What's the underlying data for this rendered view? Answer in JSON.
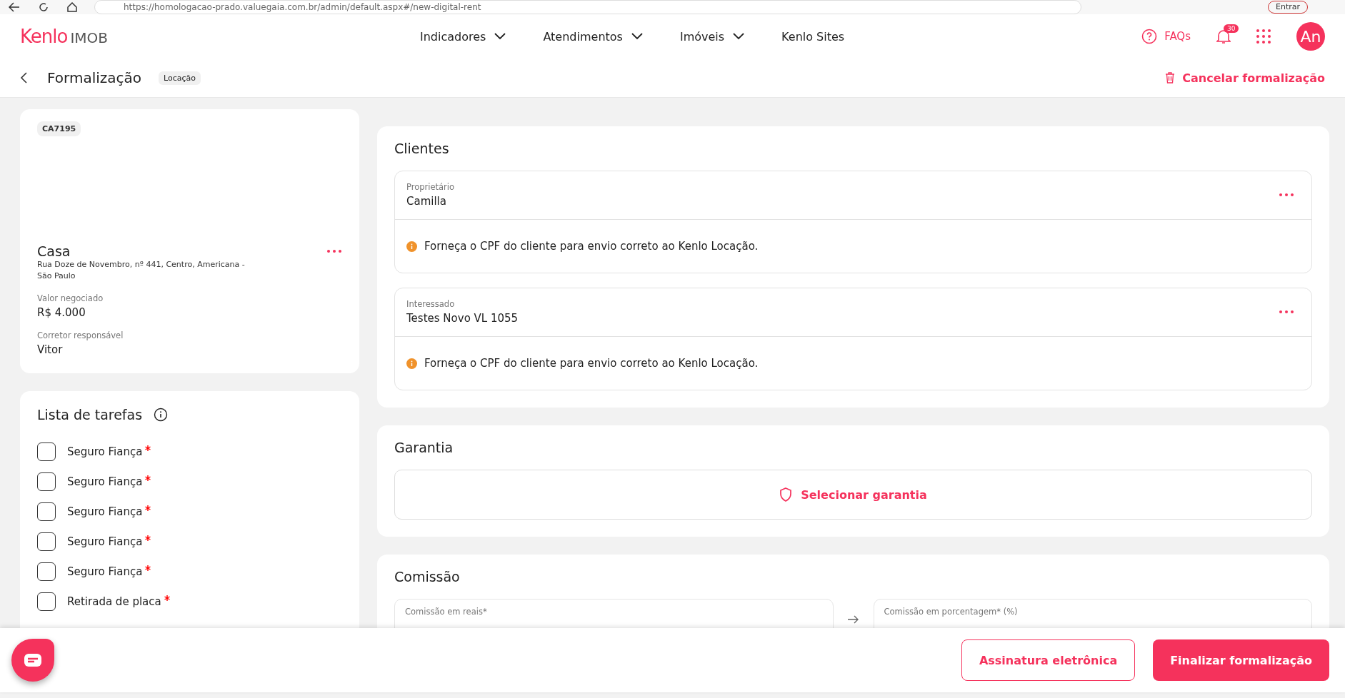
{
  "browser": {
    "url": "https://homologacao-prado.valuegaia.com.br/admin/default.aspx#/new-digital-rent",
    "sign_in": "Entrar"
  },
  "header": {
    "logo": {
      "brand": "Kenlo",
      "product": "IMOB"
    },
    "nav": [
      {
        "label": "Indicadores",
        "dropdown": true
      },
      {
        "label": "Atendimentos",
        "dropdown": true
      },
      {
        "label": "Imóveis",
        "dropdown": true
      },
      {
        "label": "Kenlo Sites",
        "dropdown": false
      }
    ],
    "faq": "FAQs",
    "notifications": "30",
    "avatar": "An"
  },
  "page": {
    "title": "Formalização",
    "tag": "Locação",
    "cancel": "Cancelar formalização"
  },
  "property": {
    "code": "CA7195",
    "type": "Casa",
    "address": "Rua Doze de Novembro, nº 441, Centro, Americana - São Paulo",
    "fields": [
      {
        "label": "Valor negociado",
        "value": "R$ 4.000"
      },
      {
        "label": "Corretor responsável",
        "value": "Vitor"
      }
    ]
  },
  "tasks": {
    "title": "Lista de tarefas",
    "items": [
      {
        "label": "Seguro Fiança",
        "checked": false,
        "required": true
      },
      {
        "label": "Seguro Fiança",
        "checked": false,
        "required": true
      },
      {
        "label": "Seguro Fiança",
        "checked": false,
        "required": true
      },
      {
        "label": "Seguro Fiança",
        "checked": false,
        "required": true
      },
      {
        "label": "Seguro Fiança",
        "checked": false,
        "required": true
      },
      {
        "label": "Retirada de placa",
        "checked": false,
        "required": true
      }
    ]
  },
  "clients": {
    "title": "Clientes",
    "items": [
      {
        "role": "Proprietário",
        "name": "Camilla",
        "warning": "Forneça o CPF do cliente para envio correto ao Kenlo Locação."
      },
      {
        "role": "Interessado",
        "name": "Testes Novo VL 1055",
        "warning": "Forneça o CPF do cliente para envio correto ao Kenlo Locação."
      }
    ]
  },
  "guarantee": {
    "title": "Garantia",
    "button": "Selecionar garantia"
  },
  "commission": {
    "title": "Comissão",
    "fields": [
      {
        "label": "Comissão em reais*"
      },
      {
        "label": "Comissão em porcentagem* (%)"
      }
    ]
  },
  "footer": {
    "buttons": [
      {
        "label": "Assinatura eletrônica",
        "kind": "outline"
      },
      {
        "label": "Finalizar formalização",
        "kind": "primary"
      }
    ]
  }
}
